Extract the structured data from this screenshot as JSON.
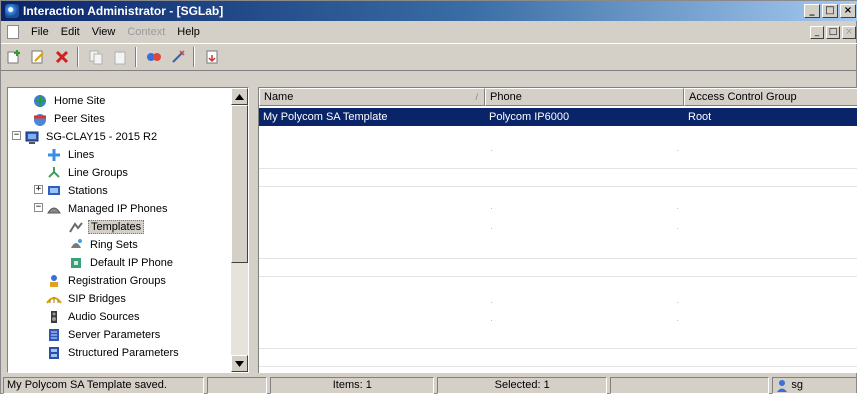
{
  "window": {
    "title": "Interaction Administrator - [SGLab]",
    "controls": {
      "minimize": "_",
      "maximize": "□",
      "close": "×"
    }
  },
  "menu": {
    "items": [
      {
        "label": "File",
        "enabled": true
      },
      {
        "label": "Edit",
        "enabled": true
      },
      {
        "label": "View",
        "enabled": true
      },
      {
        "label": "Context",
        "enabled": false
      },
      {
        "label": "Help",
        "enabled": true
      }
    ]
  },
  "toolbar": {
    "buttons": [
      "new-icon",
      "properties-icon",
      "delete-icon",
      "copy-icon",
      "paste-icon",
      "refresh-icon",
      "wizard-icon",
      "export-icon"
    ]
  },
  "tree": {
    "items": [
      {
        "label": "Home Site",
        "icon": "home-site-icon"
      },
      {
        "label": "Peer Sites",
        "icon": "peer-sites-icon"
      },
      {
        "label": "SG-CLAY15 - 2015 R2",
        "icon": "server-icon",
        "expander": "−"
      },
      {
        "label": "Lines",
        "icon": "lines-icon"
      },
      {
        "label": "Line Groups",
        "icon": "line-groups-icon"
      },
      {
        "label": "Stations",
        "icon": "stations-icon",
        "expander": "+"
      },
      {
        "label": "Managed IP Phones",
        "icon": "managed-ip-phones-icon",
        "expander": "−"
      },
      {
        "label": "Templates",
        "icon": "templates-icon",
        "selected": true
      },
      {
        "label": "Ring Sets",
        "icon": "ring-sets-icon"
      },
      {
        "label": "Default IP Phone",
        "icon": "default-ip-phone-icon"
      },
      {
        "label": "Registration Groups",
        "icon": "registration-groups-icon"
      },
      {
        "label": "SIP Bridges",
        "icon": "sip-bridges-icon"
      },
      {
        "label": "Audio Sources",
        "icon": "audio-sources-icon"
      },
      {
        "label": "Server Parameters",
        "icon": "server-parameters-icon"
      },
      {
        "label": "Structured Parameters",
        "icon": "structured-parameters-icon"
      }
    ]
  },
  "list": {
    "columns": [
      {
        "label": "Name",
        "sort_indicator": "/"
      },
      {
        "label": "Phone"
      },
      {
        "label": "Access Control Group"
      }
    ],
    "rows": [
      {
        "name": "My Polycom SA Template",
        "phone": "Polycom IP6000",
        "acg": "Root",
        "selected": true
      }
    ]
  },
  "status": {
    "message": "My Polycom SA Template saved.",
    "items": "Items: 1",
    "selected": "Selected: 1",
    "user": "sg"
  },
  "colors": {
    "selection": "#0a246a",
    "chrome": "#d4d0c8",
    "titlebar_start": "#0a246a",
    "titlebar_end": "#a6caf0"
  }
}
